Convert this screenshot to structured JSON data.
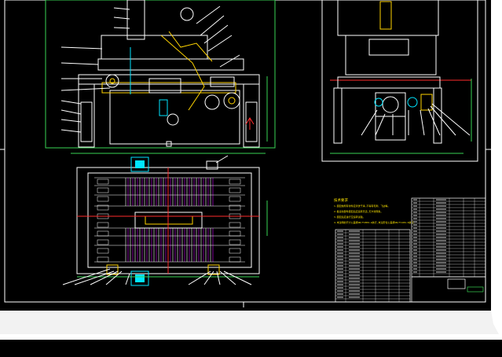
{
  "drawing": {
    "background": "#000000",
    "page_colors": {
      "paper": "#ffffff",
      "line_white": "#ffffff",
      "line_green": "#39d353",
      "line_yellow": "#ffd400",
      "line_cyan": "#00e5ff",
      "line_magenta": "#d400ff",
      "line_red": "#ff2d2d",
      "line_blue": "#3a6bff",
      "note_yellow": "#ffe600"
    },
    "views": [
      {
        "name": "front-view"
      },
      {
        "name": "side-view"
      },
      {
        "name": "top-view"
      }
    ],
    "tech_notes": {
      "heading": "技术要求",
      "lines": [
        "1.装配前所有零件应清洗干净,不得有毛刺、飞边等。",
        "2.各运动部件装配后应运转灵活,无卡滞现象。",
        "3.装配后应进行空运转试验。",
        "4.未注明的尺寸公差按GB/T1804-m执行,未注形位公差按GB/T1184-K执行。"
      ]
    }
  }
}
